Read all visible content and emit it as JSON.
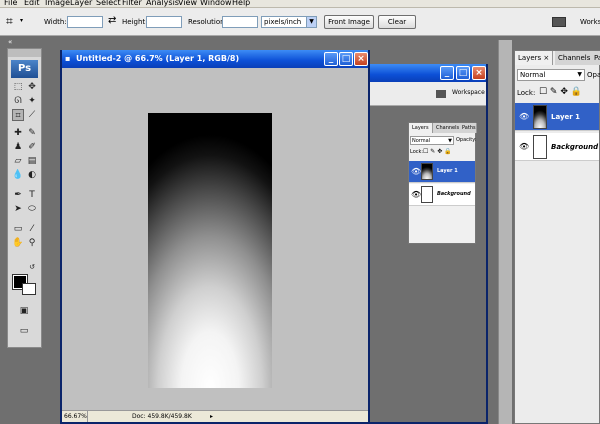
{
  "menu": [
    "File",
    "Edit",
    "Image",
    "Layer",
    "Select",
    "Filter",
    "Analysis",
    "View",
    "Window",
    "Help"
  ],
  "options": {
    "width_label": "Width:",
    "height_label": "Height:",
    "resolution_label": "Resolution:",
    "units_value": "pixels/inch",
    "front_image_label": "Front Image",
    "clear_label": "Clear",
    "workspace_label": "Works"
  },
  "toolbox": {
    "logo": "Ps",
    "collapse": "«"
  },
  "doc": {
    "title": "Untitled-2 @ 66.7% (Layer 1, RGB/8)",
    "zoom": "66.67%",
    "doc_size": "Doc: 459.8K/459.8K"
  },
  "bg_window": {
    "workspace_label": "Workspace"
  },
  "small_layers": {
    "tabs": [
      "Layers",
      "Channels",
      "Paths"
    ],
    "blend": "Normal",
    "opacity_label": "Opacity:",
    "lock_label": "Lock:",
    "layers": [
      "Layer 1",
      "Background"
    ]
  },
  "right_layers": {
    "tabs": [
      "Layers",
      "Channels",
      "Paths"
    ],
    "blend": "Normal",
    "opacity_label": "Opac",
    "lock_label": "Lock:",
    "layers": [
      "Layer 1",
      "Background"
    ]
  },
  "colors": {
    "selected_row": "#3161c7",
    "titlebar": "#0c4fd6"
  }
}
